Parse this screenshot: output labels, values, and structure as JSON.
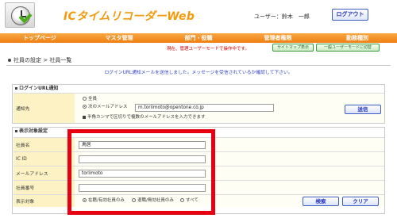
{
  "app": {
    "title": "ICタイムリコーダーWeb",
    "user_label": "ユーザー：鈴木　一郎",
    "logout_label": "ログアウト"
  },
  "nav": {
    "items": [
      "トップページ",
      "マスタ管理",
      "部門・役職",
      "管理者権限",
      "勤務種別"
    ]
  },
  "mode": {
    "warning": "現在、管理ユーザーモードで操作中です。",
    "sitemap_label": "サイトマップ表示",
    "switch_label": "一般ユーザーモードに切替"
  },
  "breadcrumb": {
    "parent": "社員の設定",
    "separator": ">",
    "current": "社員一覧"
  },
  "info_text": "ログインURL通知メールを送信しました。メッセージを受信されているか確認して下さい。",
  "login_panel": {
    "title": "ログインURL通知",
    "dest_label": "通知先",
    "option_all": "全員",
    "option_email": "次のメールアドレス",
    "email_value": "m.toriimoto@opentone.co.jp",
    "note": "半角カンマで区切りで複数のメールアドレスを入力できます",
    "send_label": "送信"
  },
  "filter_panel": {
    "title": "表示対象設定",
    "fields": [
      {
        "label": "社員名",
        "value": "鳥居"
      },
      {
        "label": "IC ID",
        "value": ""
      },
      {
        "label": "メールアドレス",
        "value": "toriimoto"
      },
      {
        "label": "社員番号",
        "value": ""
      }
    ],
    "display_label": "表示対象",
    "display_options": [
      "在籍/有効社員のみ",
      "退職/無効社員のみ",
      "すべて"
    ],
    "display_selected": 0,
    "search_label": "検索",
    "clear_label": "クリア"
  },
  "colors": {
    "accent_orange": "#f29a0c",
    "nav_orange": "#ef7f12",
    "label_bg": "#fdf2c4",
    "highlight_red": "#e60012",
    "button_blue": "#2233bb"
  }
}
